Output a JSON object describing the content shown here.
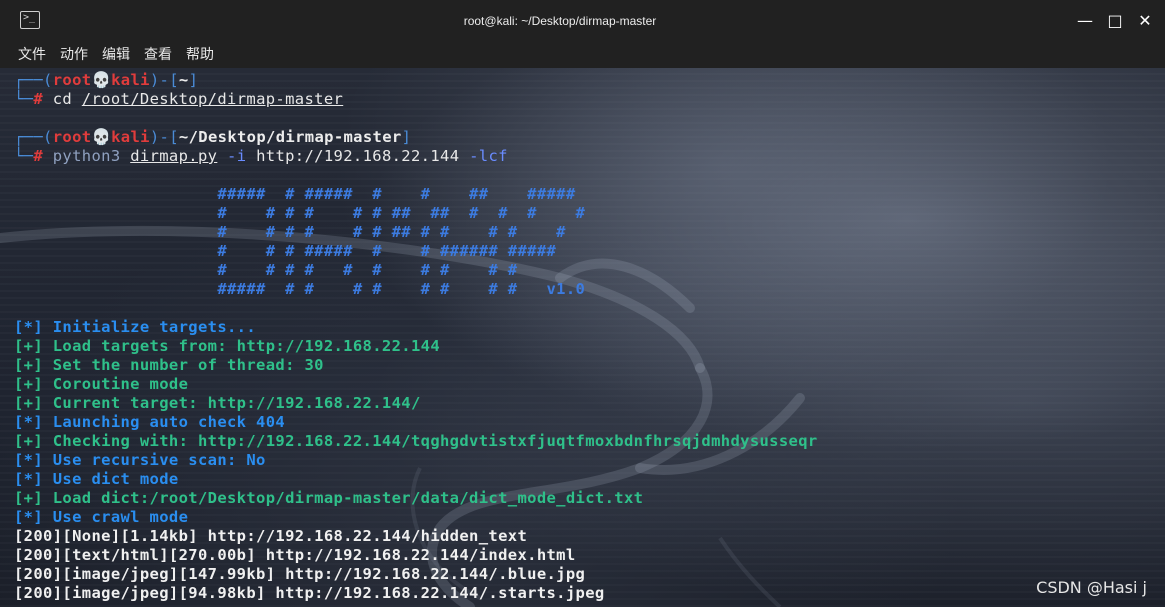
{
  "window": {
    "title": "root@kali: ~/Desktop/dirmap-master",
    "icon": "terminal-icon",
    "controls": [
      "minimize",
      "maximize",
      "close"
    ]
  },
  "menu": [
    "文件",
    "动作",
    "编辑",
    "查看",
    "帮助"
  ],
  "prompt1": {
    "open": "┌──(",
    "user": "root",
    "skull": "💀",
    "host": "kali",
    "mid": ")-[",
    "path": "~",
    "close": "]",
    "hash_prefix": "└─",
    "hash": "#",
    "cmd": " cd ",
    "arg": "/root/Desktop/dirmap-master"
  },
  "prompt2": {
    "open": "┌──(",
    "user": "root",
    "skull": "💀",
    "host": "kali",
    "mid": ")-[",
    "path": "~/Desktop/dirmap-master",
    "close": "]",
    "hash_prefix": "└─",
    "hash": "#",
    "cmd": " python3 ",
    "script": "dirmap.py",
    "flag1": " -i ",
    "url": "http://192.168.22.144",
    "flag2": " -lcf"
  },
  "banner": [
    "                     #####  # #####  #    #    ##    #####",
    "                     #    # # #    # # ##  ##  #  #  #    #",
    "                     #    # # #    # # ## # #    # #    #",
    "                     #    # # #####  #    # ###### #####",
    "                     #    # # #   #  #    # #    # #",
    "                     #####  # #    # #    # #    # #   "
  ],
  "version": "v1.0",
  "log": [
    {
      "tag": "[*]",
      "kind": "star",
      "text": " Initialize targets..."
    },
    {
      "tag": "[+]",
      "kind": "plus",
      "text": " Load targets from: http://192.168.22.144"
    },
    {
      "tag": "[+]",
      "kind": "plus",
      "text": " Set the number of thread: 30"
    },
    {
      "tag": "[+]",
      "kind": "plus",
      "text": " Coroutine mode"
    },
    {
      "tag": "[+]",
      "kind": "plus",
      "text": " Current target: http://192.168.22.144/"
    },
    {
      "tag": "[*]",
      "kind": "star",
      "text": " Launching auto check 404"
    },
    {
      "tag": "[+]",
      "kind": "plus",
      "text": " Checking with: http://192.168.22.144/tqghgdvtistxfjuqtfmoxbdnfhrsqjdmhdysusseqr"
    },
    {
      "tag": "[*]",
      "kind": "star",
      "text": " Use recursive scan: No"
    },
    {
      "tag": "[*]",
      "kind": "star",
      "text": " Use dict mode"
    },
    {
      "tag": "[+]",
      "kind": "plus",
      "text": " Load dict:/root/Desktop/dirmap-master/data/dict_mode_dict.txt"
    },
    {
      "tag": "[*]",
      "kind": "star",
      "text": " Use crawl mode"
    }
  ],
  "results": [
    "[200][None][1.14kb] http://192.168.22.144/hidden_text",
    "[200][text/html][270.00b] http://192.168.22.144/index.html",
    "[200][image/jpeg][147.99kb] http://192.168.22.144/.blue.jpg",
    "[200][image/jpeg][94.98kb] http://192.168.22.144/.starts.jpeg"
  ],
  "watermark": "CSDN @Hasi j"
}
